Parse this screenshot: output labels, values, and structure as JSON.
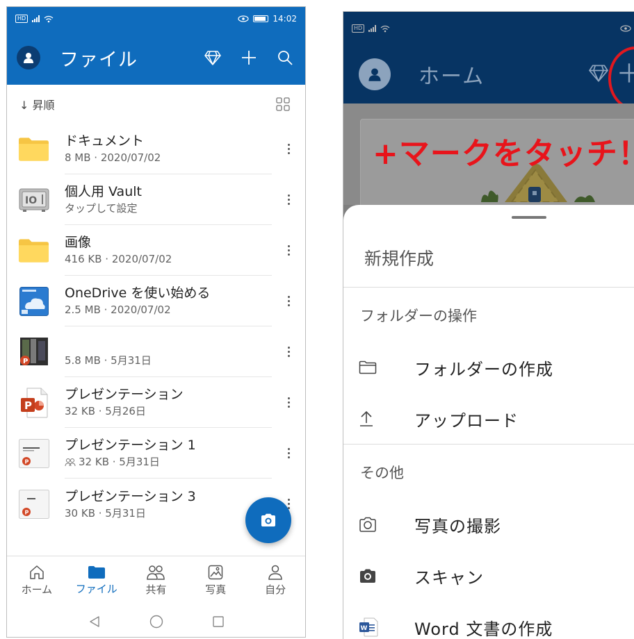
{
  "left": {
    "status": {
      "time": "14:02",
      "hd": "HD"
    },
    "app_bar": {
      "title": "ファイル"
    },
    "sort": {
      "label": "↓ 昇順"
    },
    "files": [
      {
        "name": "ドキュメント",
        "meta": "8 MB · 2020/07/02",
        "icon": "folder-icon",
        "shared": false
      },
      {
        "name": "個人用 Vault",
        "meta": "タップして設定",
        "icon": "vault-icon",
        "shared": false
      },
      {
        "name": "画像",
        "meta": "416 KB · 2020/07/02",
        "icon": "folder-icon",
        "shared": false
      },
      {
        "name": "OneDrive を使い始める",
        "meta": "2.5 MB · 2020/07/02",
        "icon": "pdf-thumbnail",
        "shared": false
      },
      {
        "name": "",
        "meta": "5.8 MB · 5月31日",
        "icon": "photo-pptx-thumbnail",
        "shared": false
      },
      {
        "name": "プレゼンテーション",
        "meta": "32 KB · 5月26日",
        "icon": "powerpoint-icon",
        "shared": false
      },
      {
        "name": "プレゼンテーション 1",
        "meta": "32 KB · 5月31日",
        "icon": "pptx-thumbnail",
        "shared": true
      },
      {
        "name": "プレゼンテーション 3",
        "meta": "30 KB · 5月31日",
        "icon": "pptx-thumbnail",
        "shared": false
      }
    ],
    "nav": [
      {
        "label": "ホーム",
        "icon": "home-icon",
        "active": false
      },
      {
        "label": "ファイル",
        "icon": "folder-filled-icon",
        "active": true
      },
      {
        "label": "共有",
        "icon": "people-icon",
        "active": false
      },
      {
        "label": "写真",
        "icon": "photo-icon",
        "active": false
      },
      {
        "label": "自分",
        "icon": "person-icon",
        "active": false
      }
    ]
  },
  "right": {
    "status": {
      "hd": "HD"
    },
    "app_bar": {
      "title": "ホーム"
    },
    "overlay_text": "+マークをタッチ！",
    "sheet": {
      "title": "新規作成",
      "sections": [
        {
          "label": "フォルダーの操作",
          "items": [
            {
              "label": "フォルダーの作成",
              "icon": "folder-outline-icon"
            },
            {
              "label": "アップロード",
              "icon": "upload-icon"
            }
          ]
        },
        {
          "label": "その他",
          "items": [
            {
              "label": "写真の撮影",
              "icon": "camera-outline-icon"
            },
            {
              "label": "スキャン",
              "icon": "camera-filled-icon"
            },
            {
              "label": "Word 文書の作成",
              "icon": "word-icon"
            }
          ]
        }
      ]
    }
  },
  "colors": {
    "brand_blue": "#0f6cbd",
    "dim_navy": "#073463",
    "annotation_red": "#e8141b"
  }
}
